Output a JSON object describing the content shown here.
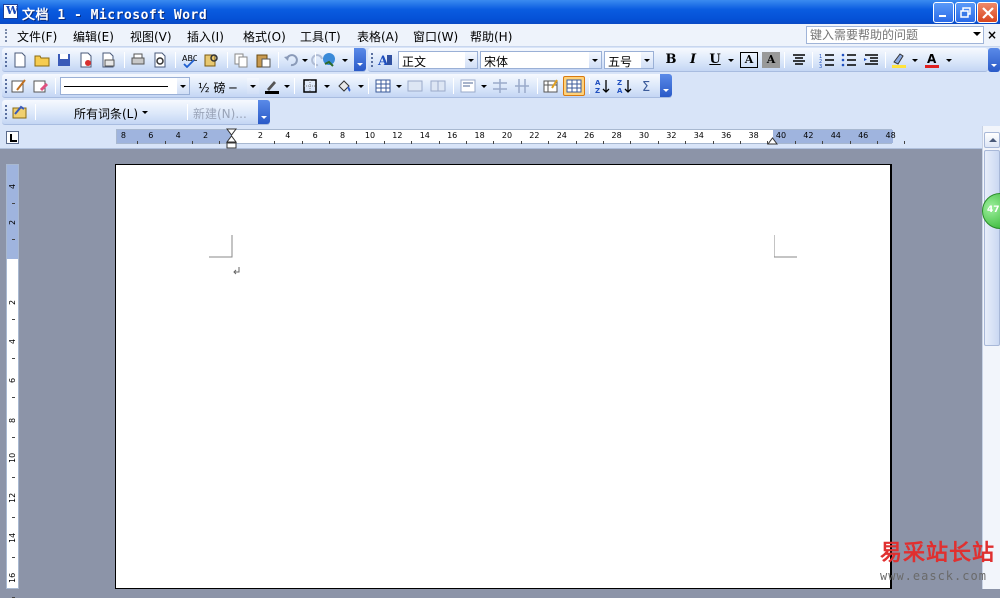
{
  "window": {
    "title": "文档 1 - Microsoft Word"
  },
  "menubar": {
    "items": [
      "文件(F)",
      "编辑(E)",
      "视图(V)",
      "插入(I)",
      "格式(O)",
      "工具(T)",
      "表格(A)",
      "窗口(W)",
      "帮助(H)"
    ],
    "help_placeholder": "键入需要帮助的问题",
    "close_glyph": "×"
  },
  "formatting": {
    "style": "正文",
    "font": "宋体",
    "size": "五号",
    "bold": "B",
    "italic": "I",
    "underline": "U",
    "char_border": "A",
    "char_shade": "A"
  },
  "tables_borders": {
    "line_width": "½ 磅",
    "line_dash": "─"
  },
  "autotext": {
    "entries_label": "所有词条(L)",
    "new_label": "新建(N)..."
  },
  "ruler": {
    "h_numbers": [
      "8",
      "6",
      "4",
      "2",
      "2",
      "4",
      "6",
      "8",
      "10",
      "12",
      "14",
      "16",
      "18",
      "20",
      "22",
      "24",
      "26",
      "28",
      "30",
      "32",
      "34",
      "36",
      "38",
      "40",
      "42",
      "44",
      "46",
      "48"
    ],
    "v_numbers": [
      "4",
      "2",
      "2",
      "4",
      "6",
      "8",
      "10",
      "12",
      "14",
      "16"
    ]
  },
  "badge": {
    "value": "47"
  },
  "watermark": {
    "cn": "易采站长站",
    "url": "www.easck.com"
  },
  "colors": {
    "titlebar": "#0551d6",
    "toolbar": "#dce8fa",
    "workspace": "#8c94a8",
    "highlight": "#ffe23c",
    "font_color": "#e02020"
  }
}
